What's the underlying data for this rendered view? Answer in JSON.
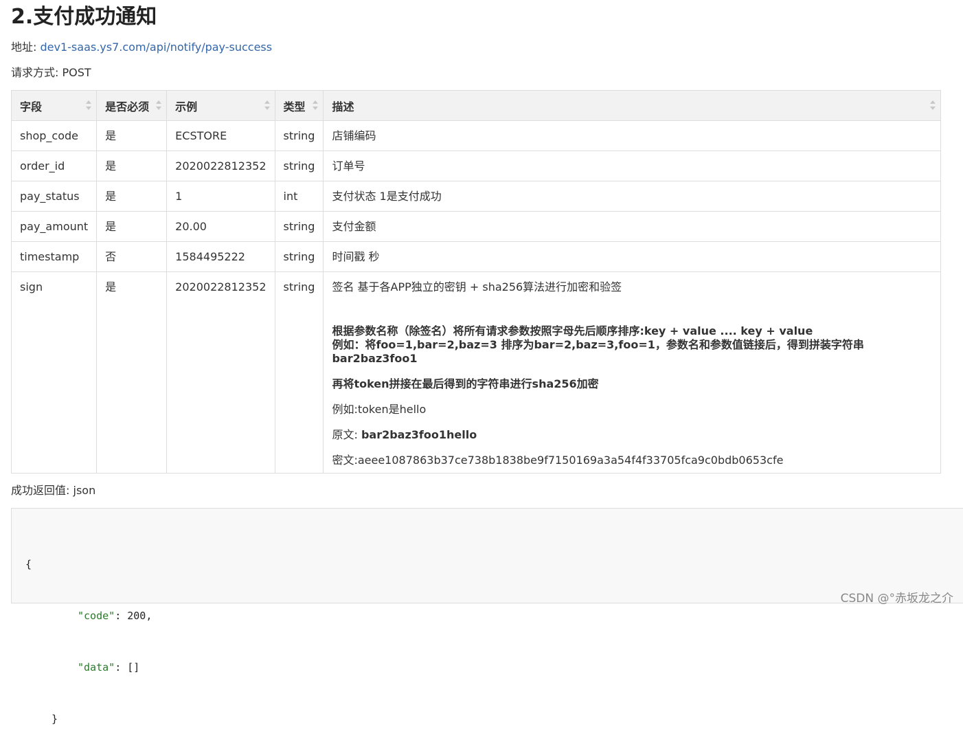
{
  "title": "2.支付成功通知",
  "address_label": "地址:",
  "address_url": "dev1-saas.ys7.com/api/notify/pay-success",
  "method_label": "请求方式:",
  "method_value": "POST",
  "table": {
    "headers": [
      "字段",
      "是否必须",
      "示例",
      "类型",
      "描述"
    ],
    "rows": [
      {
        "field": "shop_code",
        "required": "是",
        "example": "ECSTORE",
        "type": "string",
        "desc": "店铺编码"
      },
      {
        "field": "order_id",
        "required": "是",
        "example": "2020022812352",
        "type": "string",
        "desc": "订单号"
      },
      {
        "field": "pay_status",
        "required": "是",
        "example": "1",
        "type": "int",
        "desc": "支付状态 1是支付成功"
      },
      {
        "field": "pay_amount",
        "required": "是",
        "example": "20.00",
        "type": "string",
        "desc": "支付金额"
      },
      {
        "field": "timestamp",
        "required": "否",
        "example": "1584495222",
        "type": "string",
        "desc": "时间戳 秒"
      },
      {
        "field": "sign",
        "required": "是",
        "example": "2020022812352",
        "type": "string",
        "desc_lines": {
          "l1": "签名 基于各APP独立的密钥 + sha256算法进行加密和验签",
          "l2": "根据参数名称（除签名）将所有请求参数按照字母先后顺序排序:key + value .... key + value",
          "l3": "例如：将foo=1,bar=2,baz=3 排序为bar=2,baz=3,foo=1，参数名和参数值链接后，得到拼装字符串bar2baz3foo1",
          "l4": "再将token拼接在最后得到的字符串进行sha256加密",
          "l5": "例如:token是hello",
          "l6_label": "原文:",
          "l6_value": "bar2baz3foo1hello",
          "l7": "密文:aeee1087863b37ce738b1838be9f7150169a3a54f4f33705fca9c0bdb0653cfe"
        }
      }
    ]
  },
  "return_label": "成功返回值:",
  "return_value": "json",
  "code": {
    "line1": "{",
    "line2_key": "\"code\"",
    "line2_rest": ": 200,",
    "line3_key": "\"data\"",
    "line3_rest": ": []",
    "line4": "}"
  },
  "watermark": "CSDN @°赤坂龙之介"
}
